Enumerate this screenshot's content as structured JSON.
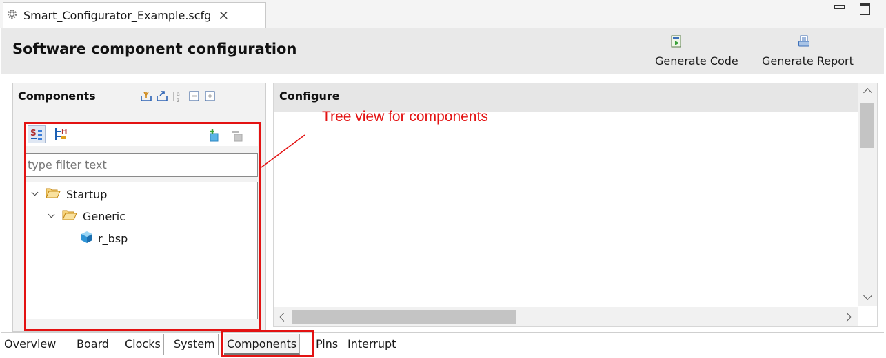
{
  "editor": {
    "tab_title": "Smart_Configurator_Example.scfg",
    "close_glyph": "×",
    "tab_icon": "gear-icon"
  },
  "header": {
    "title": "Software component configuration",
    "generate_code_label": "Generate Code",
    "generate_report_label": "Generate Report"
  },
  "components_panel": {
    "heading": "Components",
    "toolbar_icons": [
      "import-icon",
      "export-icon",
      "sort-alpha-icon",
      "collapse-all-icon",
      "expand-all-icon"
    ],
    "view_tabs": [
      "type-view-icon",
      "hierarchy-view-icon"
    ],
    "actions": [
      "add-component-icon",
      "remove-component-icon"
    ],
    "filter_placeholder": "type filter text",
    "tree": [
      {
        "label": "Startup",
        "level": 0,
        "type": "folder",
        "expanded": true
      },
      {
        "label": "Generic",
        "level": 1,
        "type": "folder",
        "expanded": true
      },
      {
        "label": "r_bsp",
        "level": 2,
        "type": "component"
      }
    ]
  },
  "configure_panel": {
    "heading": "Configure"
  },
  "annotation": {
    "text": "Tree view for components",
    "color": "#e31212"
  },
  "bottom_tabs": [
    {
      "label": "Overview",
      "active": false
    },
    {
      "label": "Board",
      "active": false
    },
    {
      "label": "Clocks",
      "active": false
    },
    {
      "label": "System",
      "active": false
    },
    {
      "label": "Components",
      "active": true
    },
    {
      "label": "Pins",
      "active": false
    },
    {
      "label": "Interrupt",
      "active": false
    }
  ]
}
